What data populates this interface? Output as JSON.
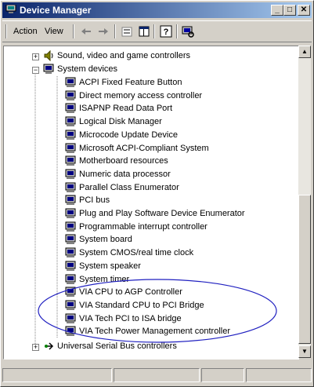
{
  "window": {
    "title": "Device Manager",
    "controls": [
      "_",
      "□",
      "✕"
    ]
  },
  "menubar": {
    "action": "Action",
    "view": "View"
  },
  "toolbar": {
    "icons": [
      "back-arrow-icon",
      "forward-arrow-icon",
      "properties-icon",
      "tree-view-icon",
      "help-icon",
      "scan-hardware-icon"
    ]
  },
  "tree": {
    "sound_label": "Sound, video and game controllers",
    "system_label": "System devices",
    "system_children": [
      "ACPI Fixed Feature Button",
      "Direct memory access controller",
      "ISAPNP Read Data Port",
      "Logical Disk Manager",
      "Microcode Update Device",
      "Microsoft ACPI-Compliant System",
      "Motherboard resources",
      "Numeric data processor",
      "Parallel Class Enumerator",
      "PCI bus",
      "Plug and Play Software Device Enumerator",
      "Programmable interrupt controller",
      "System board",
      "System CMOS/real time clock",
      "System speaker",
      "System timer",
      "VIA CPU to AGP Controller",
      "VIA Standard CPU to PCI Bridge",
      "VIA Tech PCI to ISA bridge",
      "VIA Tech Power Management controller"
    ],
    "usb_label": "Universal Serial Bus controllers"
  },
  "colors": {
    "titlebar_start": "#0a246a",
    "titlebar_end": "#a6caf0",
    "annotation_ellipse": "#2020c0"
  }
}
